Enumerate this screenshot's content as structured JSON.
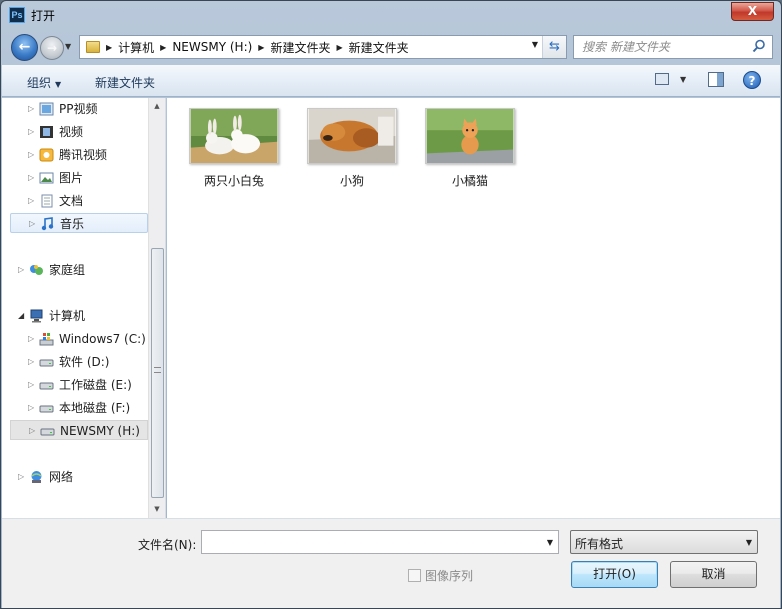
{
  "window": {
    "title": "打开",
    "app_icon": "Ps",
    "close_glyph": "X"
  },
  "nav": {
    "back_glyph": "←",
    "forward_glyph": "→",
    "breadcrumbs": [
      "计算机",
      "NEWSMY (H:)",
      "新建文件夹",
      "新建文件夹"
    ],
    "search_placeholder": "搜索 新建文件夹"
  },
  "toolbar": {
    "organize_label": "组织",
    "new_folder_label": "新建文件夹",
    "help_glyph": "?"
  },
  "sidebar": {
    "items": [
      {
        "label": "PP视频",
        "icon": "pp-video-icon"
      },
      {
        "label": "视频",
        "icon": "video-library-icon"
      },
      {
        "label": "腾讯视频",
        "icon": "tencent-video-icon"
      },
      {
        "label": "图片",
        "icon": "pictures-library-icon"
      },
      {
        "label": "文档",
        "icon": "documents-library-icon"
      },
      {
        "label": "音乐",
        "icon": "music-library-icon"
      },
      {
        "label": "家庭组",
        "icon": "homegroup-icon"
      },
      {
        "label": "计算机",
        "icon": "computer-icon"
      },
      {
        "label": "Windows7 (C:)",
        "icon": "system-drive-icon"
      },
      {
        "label": "软件 (D:)",
        "icon": "drive-icon"
      },
      {
        "label": "工作磁盘 (E:)",
        "icon": "drive-icon"
      },
      {
        "label": "本地磁盘 (F:)",
        "icon": "drive-icon"
      },
      {
        "label": "NEWSMY (H:)",
        "icon": "removable-drive-icon"
      },
      {
        "label": "网络",
        "icon": "network-icon"
      }
    ]
  },
  "files": [
    {
      "name": "两只小白兔",
      "thumb": "rabbits-photo"
    },
    {
      "name": "小狗",
      "thumb": "puppy-photo"
    },
    {
      "name": "小橘猫",
      "thumb": "orange-kitten-photo"
    }
  ],
  "bottom": {
    "filename_label": "文件名(N):",
    "filename_value": "",
    "filetype_selected": "所有格式",
    "image_sequence_label": "图像序列",
    "open_label": "打开(O)",
    "cancel_label": "取消"
  }
}
